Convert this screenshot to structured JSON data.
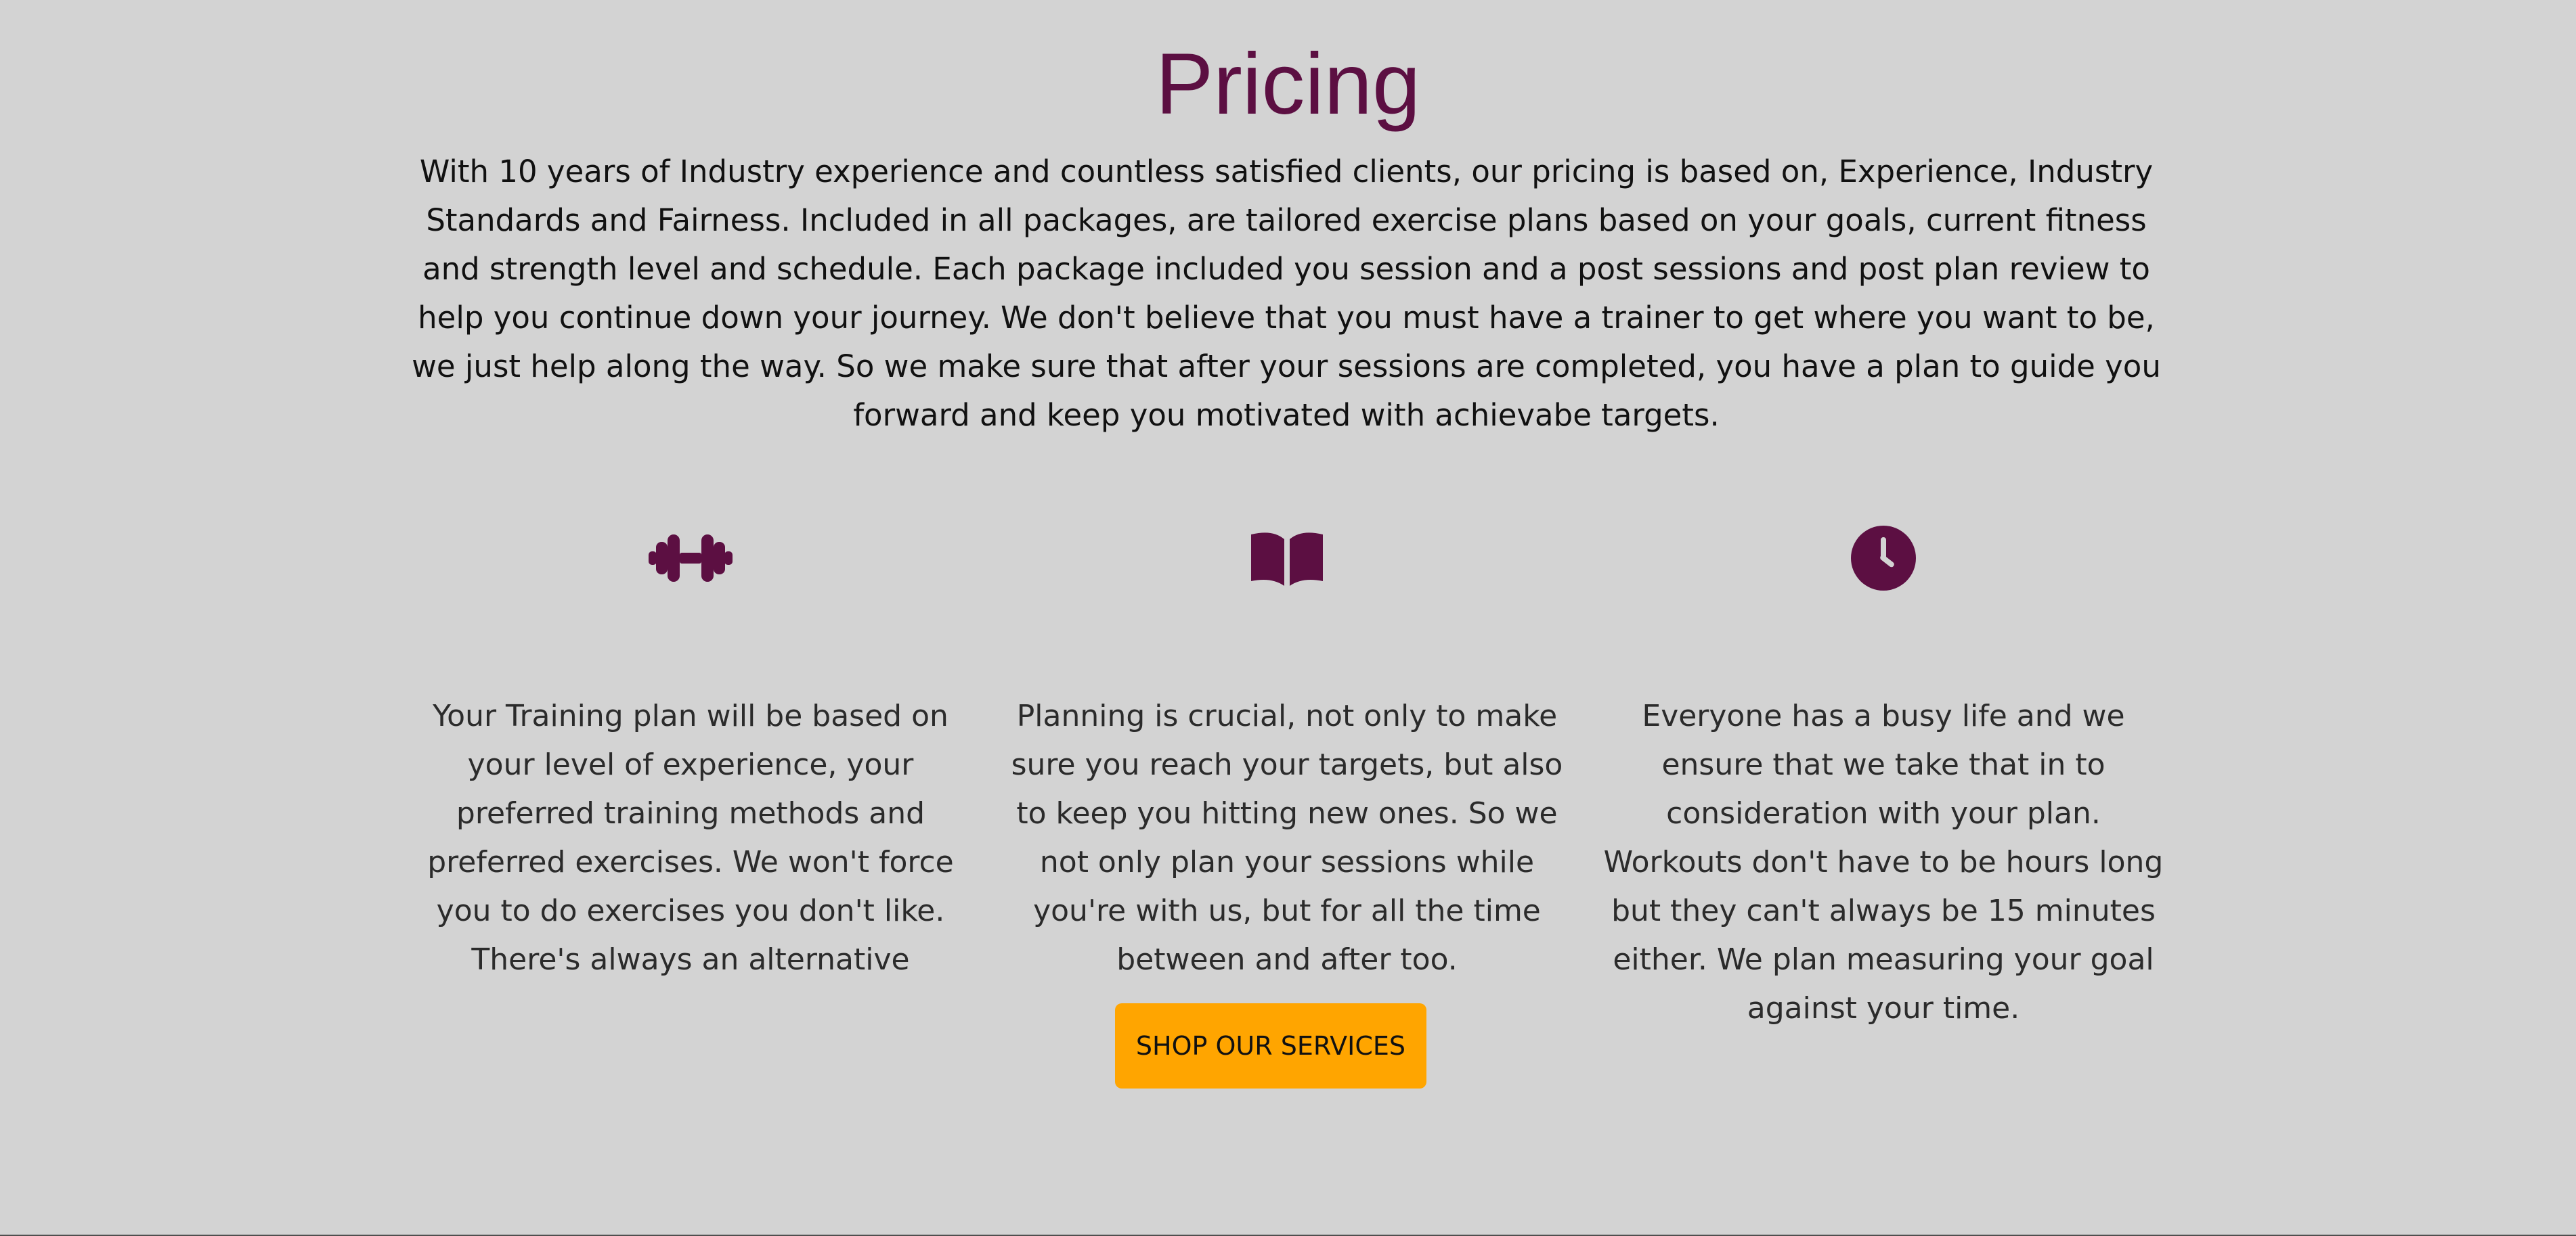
{
  "pricing": {
    "title": "Pricing",
    "intro": "With 10 years of Industry experience and countless satisfied clients, our pricing is based on, Experience, Industry Standards and Fairness. Included in all packages, are tailored exercise plans based on your goals, current fitness and strength level and schedule. Each package included you session and a post sessions and post plan review to help you continue down your journey. We don't believe that you must have a trainer to get where you want to be, we just help along the way. So we make sure that after your sessions are completed, you have a plan to guide you forward and keep you motivated with achievabe targets."
  },
  "features": [
    {
      "icon": "dumbbell-icon",
      "text": "Your Training plan will be based on your level of experience, your preferred training methods and preferred exercises. We won't force you to do exercises you don't like. There's always an alternative"
    },
    {
      "icon": "book-icon",
      "text": "Planning is crucial, not only to make sure you reach your targets, but also to keep you hitting new ones. So we not only plan your sessions while you're with us, but for all the time between and after too."
    },
    {
      "icon": "clock-icon",
      "text": "Everyone has a busy life and we ensure that we take that in to consideration with your plan. Workouts don't have to be hours long but they can't always be 15 minutes either. We plan measuring your goal against your time."
    }
  ],
  "cta": {
    "label": "SHOP OUR SERVICES"
  },
  "colors": {
    "accent": "#5c0f42",
    "button": "#ffa500",
    "background": "#d3d3d3"
  }
}
